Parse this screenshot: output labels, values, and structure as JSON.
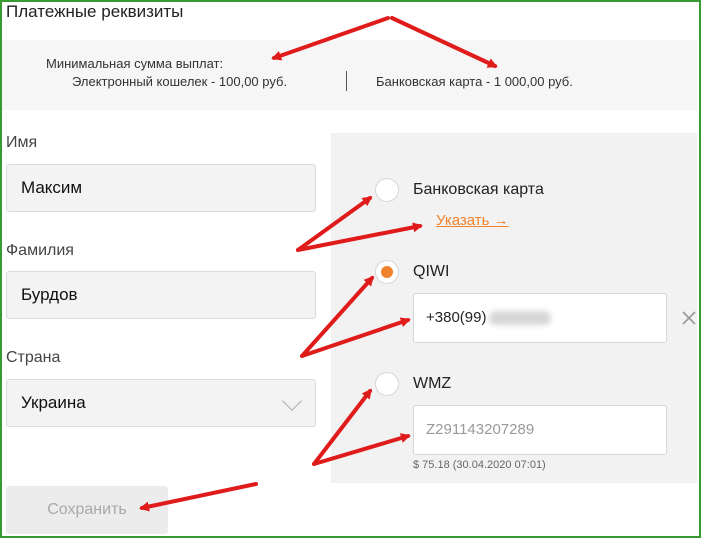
{
  "header": {
    "title": "Платежные реквизиты"
  },
  "minimum": {
    "label": "Минимальная сумма выплат:",
    "wallet": "Электронный кошелек - 100,00 руб.",
    "card": "Банковская карта - 1 000,00 руб."
  },
  "form": {
    "first_name": {
      "label": "Имя",
      "value": "Максим"
    },
    "last_name": {
      "label": "Фамилия",
      "value": "Бурдов"
    },
    "country": {
      "label": "Страна",
      "value": "Украина"
    }
  },
  "payment": {
    "card": {
      "label": "Банковская карта",
      "link": "Указать →",
      "checked": false
    },
    "qiwi": {
      "label": "QIWI",
      "value": "+380(99)",
      "checked": true
    },
    "wmz": {
      "label": "WMZ",
      "placeholder": "Z291143207289",
      "balance": "$ 75.18 (30.04.2020 07:01)",
      "checked": false
    }
  },
  "actions": {
    "save_label": "Сохранить"
  },
  "colors": {
    "accent": "#f2822b",
    "annotation": "#e01b1b",
    "frame": "#3a9a32"
  },
  "icons": {
    "close": "close-icon",
    "chevron": "chevron-down-icon"
  }
}
